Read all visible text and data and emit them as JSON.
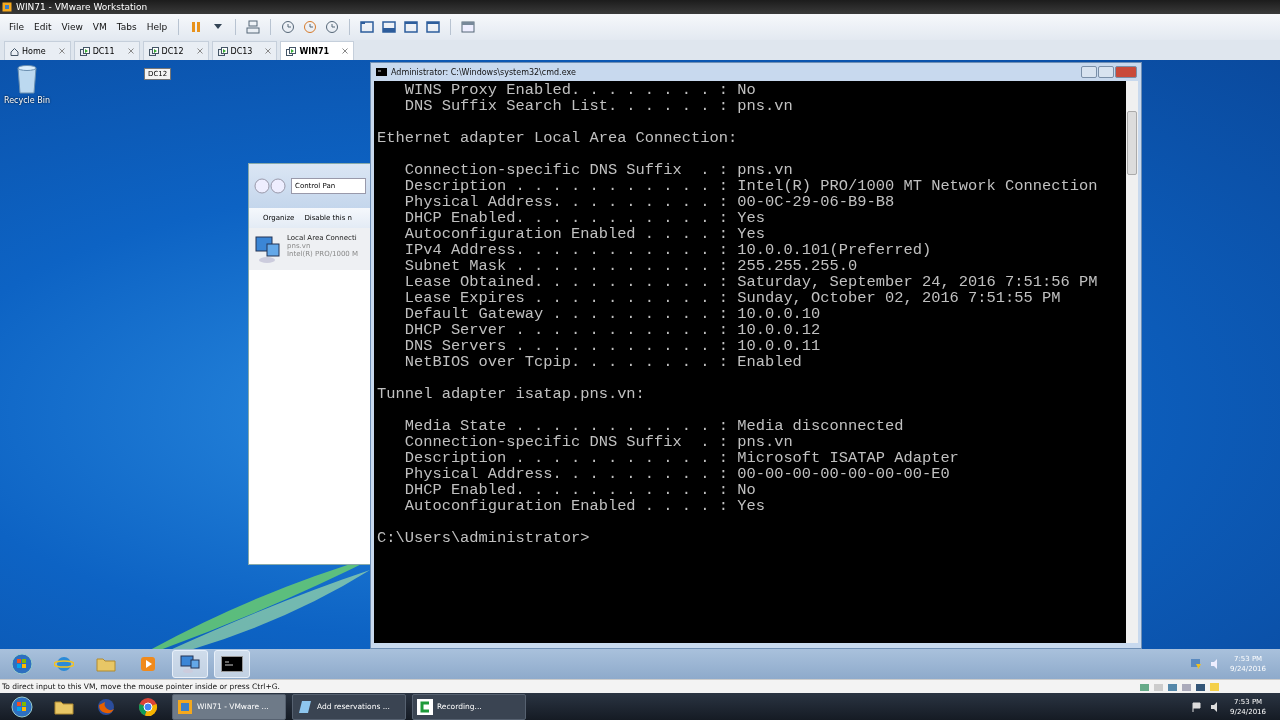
{
  "app": {
    "title": "WIN71 - VMware Workstation"
  },
  "menu": [
    "File",
    "Edit",
    "View",
    "VM",
    "Tabs",
    "Help"
  ],
  "tabs": [
    {
      "label": "Home",
      "kind": "home",
      "selected": false
    },
    {
      "label": "DC11",
      "kind": "vm",
      "selected": false
    },
    {
      "label": "DC12",
      "kind": "vm",
      "selected": false
    },
    {
      "label": "DC13",
      "kind": "vm",
      "selected": false
    },
    {
      "label": "WIN71",
      "kind": "vm",
      "selected": true
    }
  ],
  "tooltip": "DC12",
  "desktop": {
    "icons": [
      {
        "label": "Recycle Bin"
      }
    ]
  },
  "explorer": {
    "breadcrumb": "Control Pan",
    "toolbar": [
      "Organize",
      "Disable this n"
    ],
    "item": {
      "name": "Local Area Connecti",
      "lines": [
        "pns.vn",
        "Intel(R) PRO/1000 M"
      ]
    }
  },
  "console": {
    "title": "Administrator: C:\\Windows\\system32\\cmd.exe",
    "blocks": [
      [
        "   WINS Proxy Enabled. . . . . . . . : No",
        "   DNS Suffix Search List. . . . . . : pns.vn"
      ],
      [
        "Ethernet adapter Local Area Connection:"
      ],
      [
        "   Connection-specific DNS Suffix  . : pns.vn",
        "   Description . . . . . . . . . . . : Intel(R) PRO/1000 MT Network Connection",
        "   Physical Address. . . . . . . . . : 00-0C-29-06-B9-B8",
        "   DHCP Enabled. . . . . . . . . . . : Yes",
        "   Autoconfiguration Enabled . . . . : Yes",
        "   IPv4 Address. . . . . . . . . . . : 10.0.0.101(Preferred)",
        "   Subnet Mask . . . . . . . . . . . : 255.255.255.0",
        "   Lease Obtained. . . . . . . . . . : Saturday, September 24, 2016 7:51:56 PM",
        "   Lease Expires . . . . . . . . . . : Sunday, October 02, 2016 7:51:55 PM",
        "   Default Gateway . . . . . . . . . : 10.0.0.10",
        "   DHCP Server . . . . . . . . . . . : 10.0.0.12",
        "   DNS Servers . . . . . . . . . . . : 10.0.0.11",
        "   NetBIOS over Tcpip. . . . . . . . : Enabled"
      ],
      [
        "Tunnel adapter isatap.pns.vn:"
      ],
      [
        "   Media State . . . . . . . . . . . : Media disconnected",
        "   Connection-specific DNS Suffix  . : pns.vn",
        "   Description . . . . . . . . . . . : Microsoft ISATAP Adapter",
        "   Physical Address. . . . . . . . . : 00-00-00-00-00-00-00-E0",
        "   DHCP Enabled. . . . . . . . . . . : No",
        "   Autoconfiguration Enabled . . . . : Yes"
      ],
      [
        "C:\\Users\\administrator>"
      ]
    ]
  },
  "guest_taskbar": {
    "buttons": [
      {
        "kind": "start",
        "active": false
      },
      {
        "kind": "browser",
        "active": false
      },
      {
        "kind": "folder",
        "active": false
      },
      {
        "kind": "media",
        "active": false
      },
      {
        "kind": "network",
        "active": true
      },
      {
        "kind": "console",
        "active": true
      }
    ],
    "time": "7:53 PM",
    "date": "9/24/2016"
  },
  "status_bar": {
    "text": "To direct input to this VM, move the mouse pointer inside or press Ctrl+G."
  },
  "host_taskbar": {
    "pinned": [
      {
        "kind": "start"
      },
      {
        "kind": "folder"
      },
      {
        "kind": "firefox"
      },
      {
        "kind": "chrome"
      }
    ],
    "tasks": [
      {
        "label": "WIN71 - VMware ...",
        "kind": "vmware",
        "active": true
      },
      {
        "label": "Add reservations ...",
        "kind": "dhcp",
        "active": false
      },
      {
        "label": "Recording...",
        "kind": "recorder",
        "active": false
      }
    ],
    "time": "7:53 PM",
    "date": "9/24/2016"
  }
}
